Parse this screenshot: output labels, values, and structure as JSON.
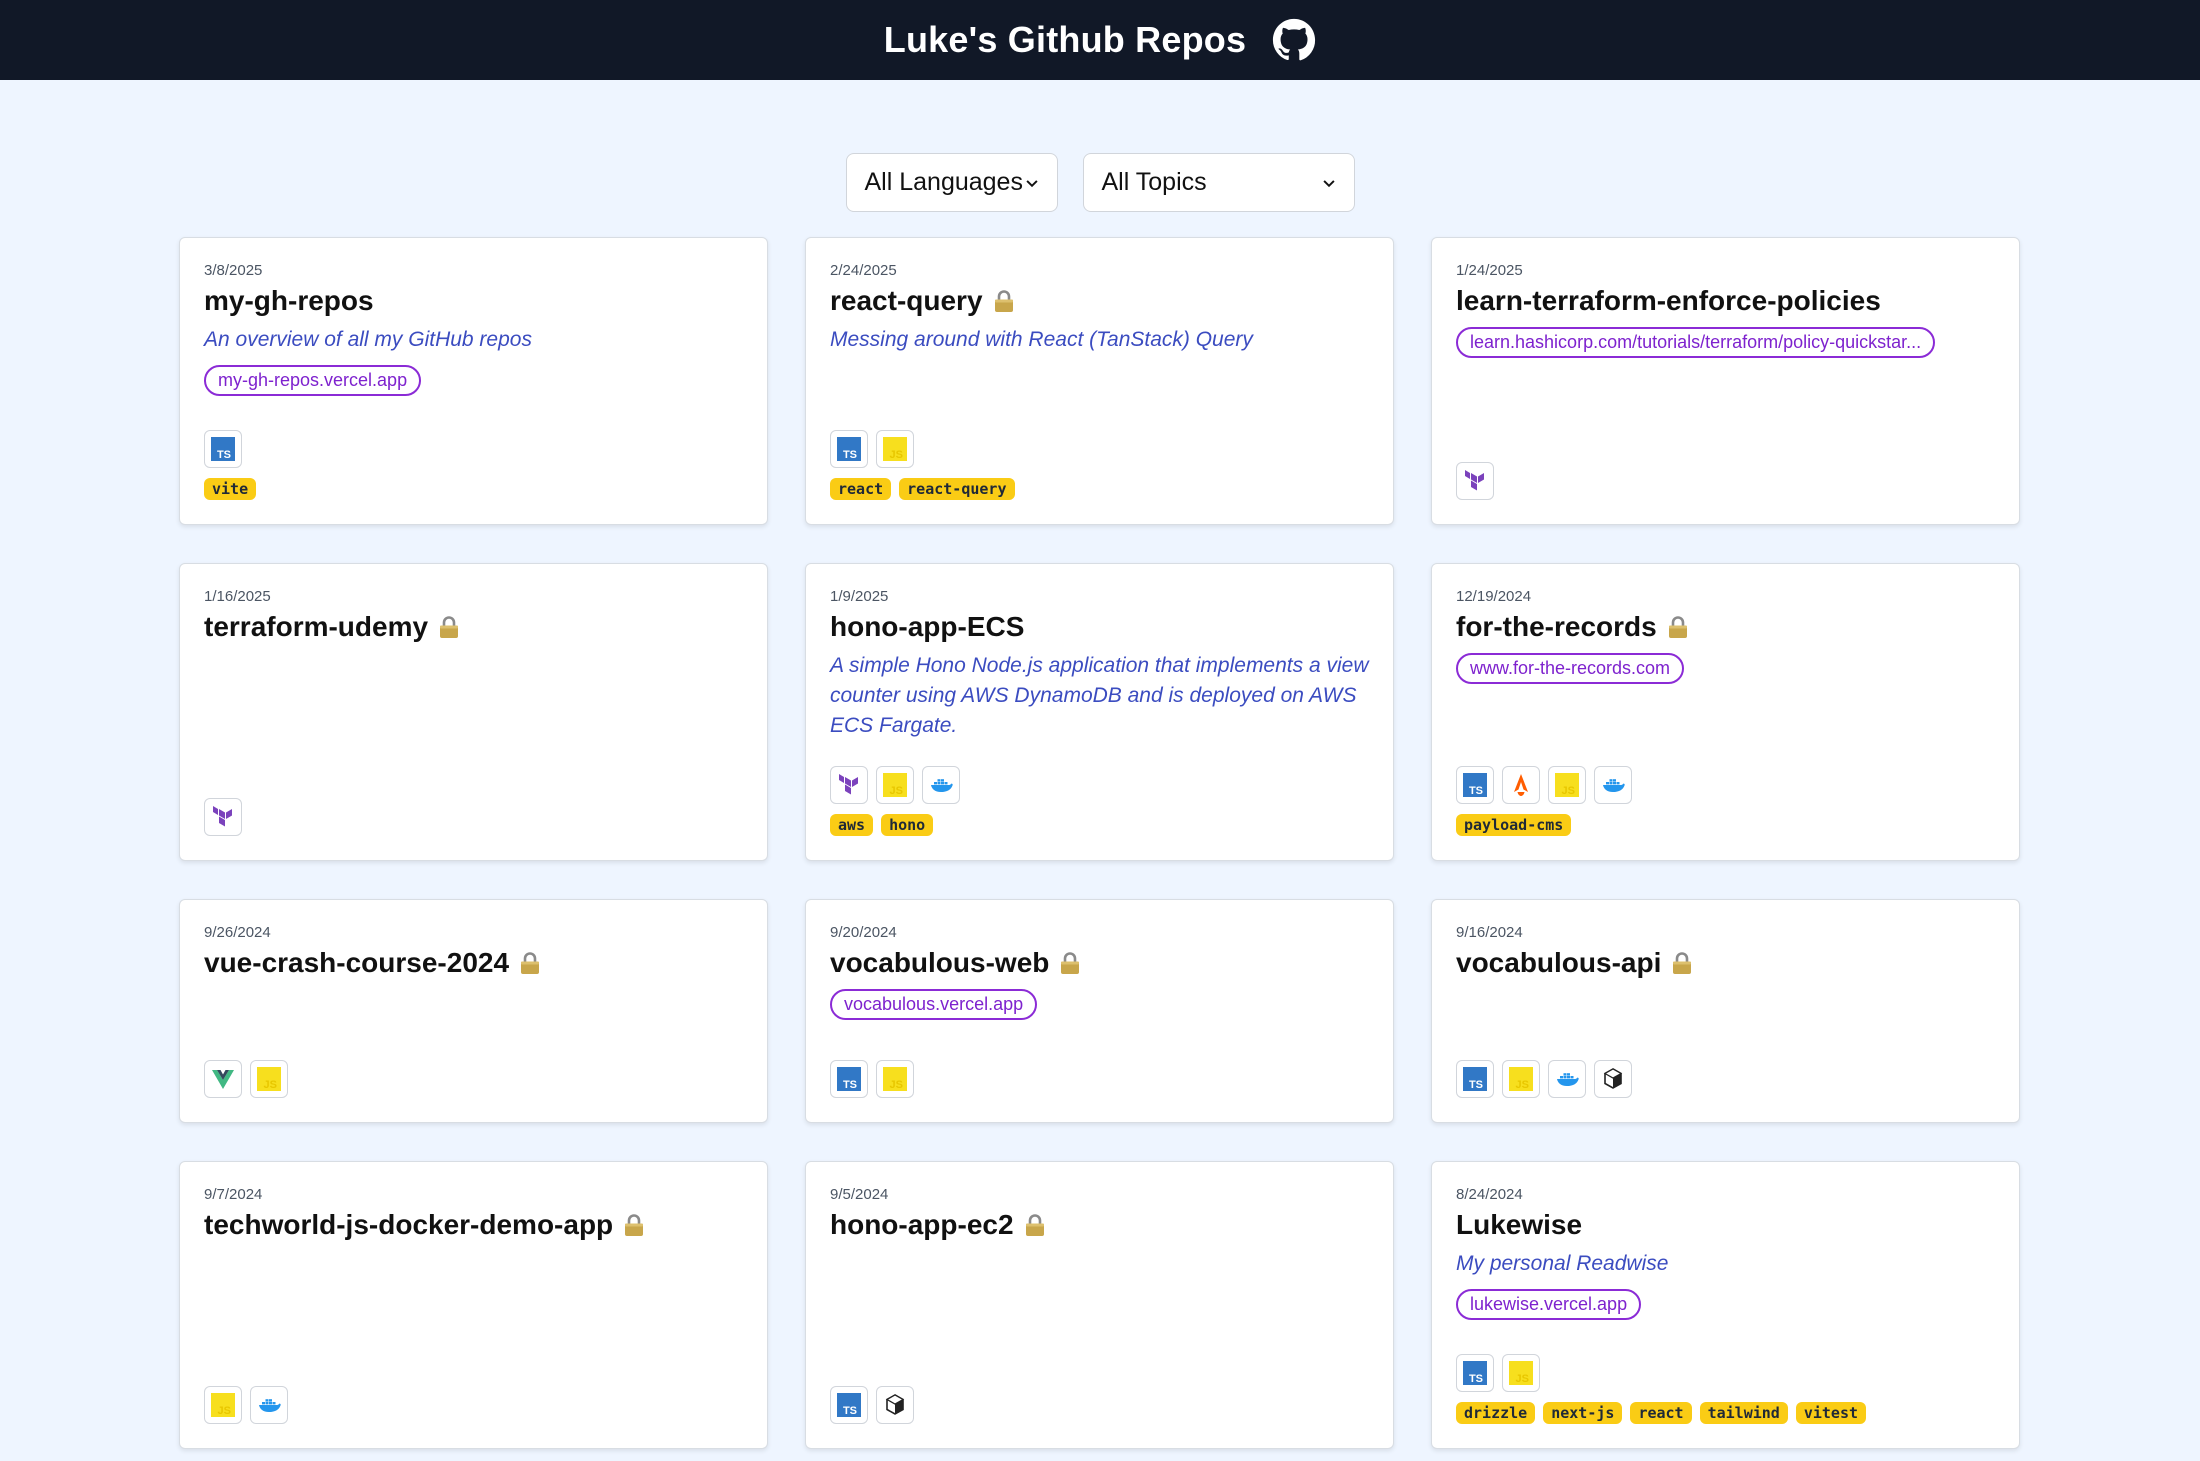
{
  "header": {
    "title": "Luke's Github Repos",
    "icon": "github-icon"
  },
  "filters": {
    "language": {
      "selected": "All Languages"
    },
    "topic": {
      "selected": "All Topics"
    }
  },
  "colors": {
    "header_bg": "#111827",
    "page_bg": "#eef5ff",
    "link": "#7e22ce",
    "description": "#3b4cc0",
    "tag_bg": "#facc15"
  },
  "repos": [
    {
      "date": "3/8/2025",
      "name": "my-gh-repos",
      "private": false,
      "description": "An overview of all my GitHub repos",
      "link": "my-gh-repos.vercel.app",
      "languages": [
        "ts"
      ],
      "tags": [
        "vite"
      ]
    },
    {
      "date": "2/24/2025",
      "name": "react-query",
      "private": true,
      "description": "Messing around with React (TanStack) Query",
      "link": "",
      "languages": [
        "ts",
        "js"
      ],
      "tags": [
        "react",
        "react-query"
      ]
    },
    {
      "date": "1/24/2025",
      "name": "learn-terraform-enforce-policies",
      "private": false,
      "description": "",
      "link": "learn.hashicorp.com/tutorials/terraform/policy-quickstar...",
      "languages": [
        "terraform"
      ],
      "tags": []
    },
    {
      "date": "1/16/2025",
      "name": "terraform-udemy",
      "private": true,
      "description": "",
      "link": "",
      "languages": [
        "terraform"
      ],
      "tags": []
    },
    {
      "date": "1/9/2025",
      "name": "hono-app-ECS",
      "private": false,
      "description": "A simple Hono Node.js application that implements a view counter using AWS DynamoDB and is deployed on AWS ECS Fargate.",
      "link": "",
      "languages": [
        "terraform",
        "js",
        "docker"
      ],
      "tags": [
        "aws",
        "hono"
      ]
    },
    {
      "date": "12/19/2024",
      "name": "for-the-records",
      "private": true,
      "description": "",
      "link": "www.for-the-records.com",
      "languages": [
        "ts",
        "astro",
        "js",
        "docker"
      ],
      "tags": [
        "payload-cms"
      ]
    },
    {
      "date": "9/26/2024",
      "name": "vue-crash-course-2024",
      "private": true,
      "description": "",
      "link": "",
      "languages": [
        "vue",
        "js"
      ],
      "tags": []
    },
    {
      "date": "9/20/2024",
      "name": "vocabulous-web",
      "private": true,
      "description": "",
      "link": "vocabulous.vercel.app",
      "languages": [
        "ts",
        "js"
      ],
      "tags": []
    },
    {
      "date": "9/16/2024",
      "name": "vocabulous-api",
      "private": true,
      "description": "",
      "link": "",
      "languages": [
        "ts",
        "js",
        "docker",
        "bun"
      ],
      "tags": []
    },
    {
      "date": "9/7/2024",
      "name": "techworld-js-docker-demo-app",
      "private": true,
      "description": "",
      "link": "",
      "languages": [
        "js",
        "docker"
      ],
      "tags": []
    },
    {
      "date": "9/5/2024",
      "name": "hono-app-ec2",
      "private": true,
      "description": "",
      "link": "",
      "languages": [
        "ts",
        "bun"
      ],
      "tags": []
    },
    {
      "date": "8/24/2024",
      "name": "Lukewise",
      "private": false,
      "description": "My personal Readwise",
      "link": "lukewise.vercel.app",
      "languages": [
        "ts",
        "js"
      ],
      "tags": [
        "drizzle",
        "next-js",
        "react",
        "tailwind",
        "vitest"
      ]
    }
  ]
}
